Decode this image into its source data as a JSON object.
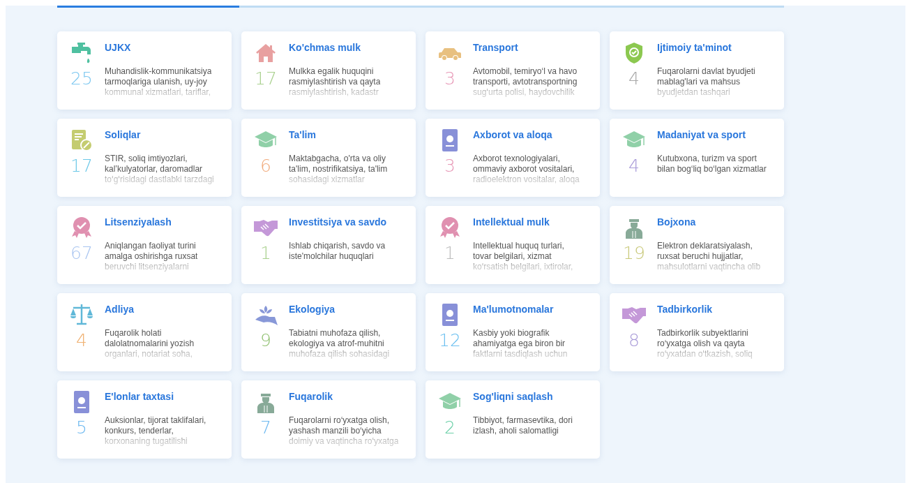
{
  "progress": {
    "level": 0.25
  },
  "categories": [
    {
      "title": "UJKX",
      "kind": "tap",
      "count": "25",
      "color": "#7ec8f0",
      "lines": [
        "Muhandislik-kommunikatsiya",
        "tarmoqlariga ulanish, uy-joy",
        "kommunal xizmatlari, tariflar,"
      ]
    },
    {
      "title": "Ko'chmas mulk",
      "kind": "house",
      "count": "17",
      "color": "#a8d08d",
      "lines": [
        "Mulkka egalik huquqini",
        "rasmiylashtirish va qayta",
        "rasmiylashtirish, kadastr"
      ]
    },
    {
      "title": "Transport",
      "kind": "car",
      "count": "3",
      "color": "#e89ab8",
      "lines": [
        "Avtomobil, temiryo‘l va havo",
        "transporti, avtotransportning",
        "sug‘urta polisi, haydovchilik"
      ]
    },
    {
      "title": "Ijtimoiy ta'minot",
      "kind": "shield",
      "count": "4",
      "color": "#a8a8a8",
      "lines": [
        "Fuqarolarni davlat byudjeti",
        "mablag'lari va mahsus",
        "byudjetdan tashqari"
      ]
    },
    {
      "title": "Soliqlar",
      "kind": "tax",
      "count": "17",
      "color": "#6cc8e8",
      "lines": [
        "STIR, soliq imtiyozlari,",
        "kal’kulyatorlar, daromadlar",
        "to‘g‘risidagi dastlabki tarzdagi"
      ]
    },
    {
      "title": "Ta'lim",
      "kind": "cap",
      "count": "6",
      "color": "#f0a878",
      "lines": [
        "Maktabgacha, o'rta va oliy",
        "ta'lim, nostrifikatsiya, ta'lim",
        "sohasidagi xizmatlar"
      ]
    },
    {
      "title": "Axborot va aloqa",
      "kind": "card",
      "count": "3",
      "color": "#e89ab8",
      "lines": [
        "Axborot texnologiyalari,",
        "ommaviy axborot vositalari,",
        "radioelektron vositalar, aloqa"
      ]
    },
    {
      "title": "Madaniyat va sport",
      "kind": "cap",
      "count": "4",
      "color": "#a89ad8",
      "lines": [
        "Kutubxona, turizm va sport",
        "bilan bog‘liq bo‘lgan xizmatlar"
      ]
    },
    {
      "title": "Litsenziyalash",
      "kind": "award",
      "count": "67",
      "color": "#a8c4f0",
      "lines": [
        "Aniqlangan faoliyat turini",
        "amalga oshirishga ruxsat",
        "beruvchi litsenziyalarni"
      ]
    },
    {
      "title": "Investitsiya va savdo",
      "kind": "handshake",
      "count": "1",
      "color": "#a8d08d",
      "lines": [
        "Ishlab chiqarish, savdo va",
        "iste'molchilar huquqlari"
      ]
    },
    {
      "title": "Intellektual mulk",
      "kind": "award",
      "count": "1",
      "color": "#bbbbbb",
      "lines": [
        "Intellektual huquq turlari,",
        "tovar belgilari, xizmat",
        "ko‘rsatish belgilari, ixtirolar,"
      ]
    },
    {
      "title": "Bojxona",
      "kind": "officer",
      "count": "19",
      "color": "#c8c878",
      "lines": [
        "Elektron deklaratsiyalash,",
        "ruxsat beruchi hujjatlar,",
        "mahsulotlarni vaqtincha olib"
      ]
    },
    {
      "title": "Adliya",
      "kind": "scales",
      "count": "4",
      "color": "#f0b070",
      "lines": [
        "Fuqarolik holati",
        "dalolatnomalarini yozish",
        "organlari, notariat soha,"
      ]
    },
    {
      "title": "Ekologiya",
      "kind": "plant",
      "count": "9",
      "color": "#90c070",
      "lines": [
        "Tabiatni muhofaza qilish,",
        "ekologiya va atrof-muhitni",
        "muhofaza qilish sohasidagi"
      ]
    },
    {
      "title": "Ma'lumotnomalar",
      "kind": "card",
      "count": "12",
      "color": "#6cc0f0",
      "lines": [
        "Kasbiy yoki biografik",
        "ahamiyatga ega biron bir",
        "faktlarni tasdiqlash uchun"
      ]
    },
    {
      "title": "Tadbirkorlik",
      "kind": "handshake",
      "count": "8",
      "color": "#a89ad8",
      "lines": [
        "Tadbirkorlik subyektlarini",
        "ro‘yxatga olish va qayta",
        "ro‘yxatdan o‘tkazish, soliq"
      ]
    },
    {
      "title": "E'lonlar taxtasi",
      "kind": "card",
      "count": "5",
      "color": "#6cb8f0",
      "lines": [
        "Auksionlar, tijorat taklifalari,",
        "konkurs, tenderlar,",
        "korxonaning tugatilishi"
      ]
    },
    {
      "title": "Fuqarolik",
      "kind": "officer",
      "count": "7",
      "color": "#6cb8f0",
      "lines": [
        "Fuqarolarni ro‘yxatga olish,",
        "yashash manzili bo‘yicha",
        "doimiy va vaqtincha ro‘yxatga"
      ]
    },
    {
      "title": "Sog'liqni saqlash",
      "kind": "cap",
      "count": "2",
      "color": "#6cd0a8",
      "lines": [
        "Tibbiyot, farmasevtika, dori",
        "izlash, aholi salomatligi"
      ]
    }
  ]
}
